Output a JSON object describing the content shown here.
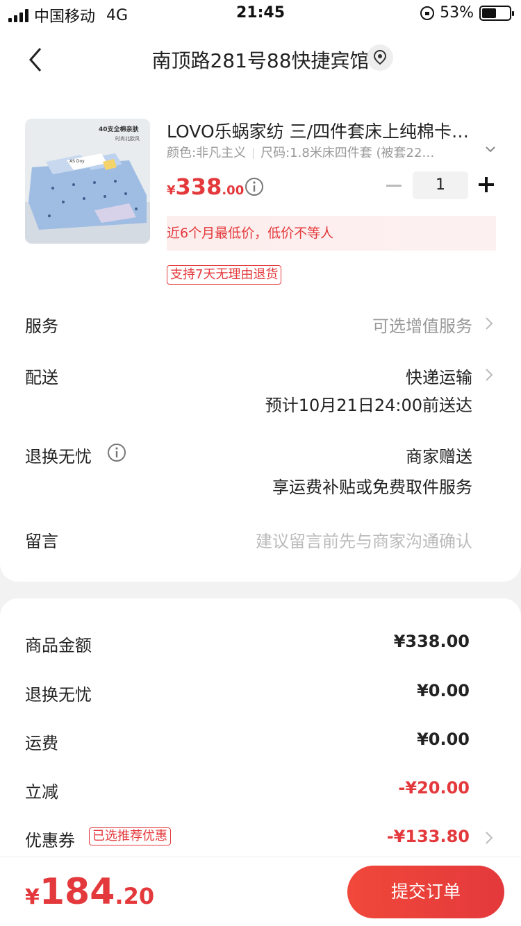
{
  "status_bar": {
    "carrier": "中国移动",
    "network": "4G",
    "time": "21:45",
    "battery": "53%",
    "battery_level": 0.53
  },
  "header": {
    "title": "南顶路281号88快捷宾馆",
    "back_icon": "chevron-left-icon",
    "location_icon": "location-pin-icon"
  },
  "product": {
    "title": "LOVO乐蜗家纺 三/四件套床上纯棉卡…",
    "color": "颜色:非凡主义",
    "size": "尺码:1.8米床四件套 (被套22…",
    "price_symbol": "¥",
    "price_int": "338",
    "price_dec": ".00",
    "quantity": "1",
    "lowest_price_note": "近6个月最低价，低价不等人",
    "return_tag": "支持7天无理由退货",
    "image_text_1": "40支全棉亲肤",
    "image_text_2": "时尚北欧风",
    "image_text_3": "AS Doy"
  },
  "rows": {
    "service_label": "服务",
    "service_value": "可选增值服务",
    "delivery_label": "配送",
    "delivery_value": "快递运输",
    "delivery_eta": "预计10月21日24:00前送达",
    "return_label": "退换无忧",
    "return_value": "商家赠送",
    "return_sub": "享运费补贴或免费取件服务",
    "message_label": "留言",
    "message_placeholder": "建议留言前先与商家沟通确认"
  },
  "summary": {
    "goods_label": "商品金额",
    "goods_value": "¥338.00",
    "return_label": "退换无忧",
    "return_value": "¥0.00",
    "shipping_label": "运费",
    "shipping_value": "¥0.00",
    "discount_label": "立减",
    "discount_value": "-¥20.00",
    "coupon_label": "优惠券",
    "coupon_tag": "已选推荐优惠",
    "coupon_value": "-¥133.80"
  },
  "bottom": {
    "total_symbol": "¥",
    "total_int": "184",
    "total_dec": ".20",
    "submit_label": "提交订单"
  },
  "colors": {
    "accent_red": "#e4393c",
    "muted_gray": "#999999"
  }
}
